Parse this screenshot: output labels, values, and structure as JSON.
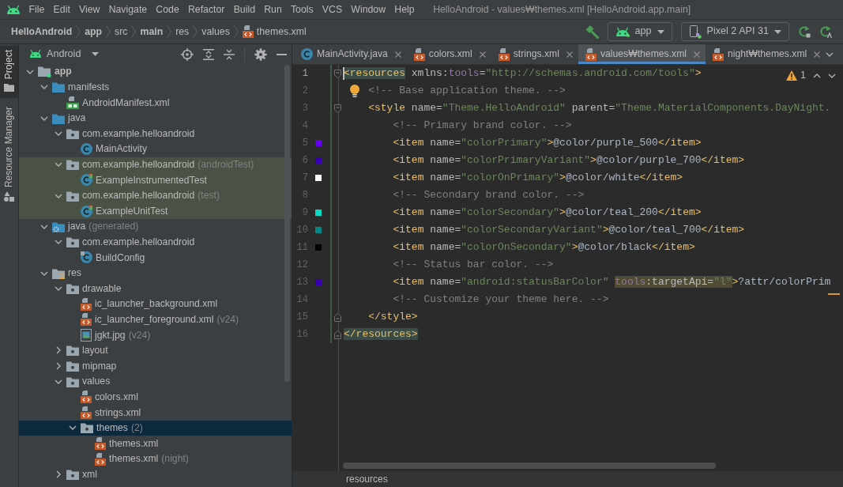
{
  "menu_bar": {
    "items": [
      "File",
      "Edit",
      "View",
      "Navigate",
      "Code",
      "Refactor",
      "Build",
      "Run",
      "Tools",
      "VCS",
      "Window",
      "Help"
    ]
  },
  "window_title": "HelloAndroid - values₩themes.xml [HelloAndroid.app.main]",
  "navigation_bar": {
    "breadcrumbs": [
      {
        "label": "HelloAndroid",
        "kind": "folder",
        "bold": true
      },
      {
        "label": "app",
        "kind": "folder",
        "bold": true
      },
      {
        "label": "src",
        "kind": "folder",
        "bold": false
      },
      {
        "label": "main",
        "kind": "folder",
        "bold": true
      },
      {
        "label": "res",
        "kind": "folder",
        "bold": false
      },
      {
        "label": "values",
        "kind": "folder",
        "bold": false
      },
      {
        "label": "themes.xml",
        "kind": "xml",
        "bold": false
      }
    ],
    "run_configuration": "app",
    "device": "Pixel 2 API 31"
  },
  "tool_window_bar": [
    {
      "label": "Project",
      "kind": "project",
      "selected": true
    },
    {
      "label": "Resource Manager",
      "kind": "resources",
      "selected": false
    }
  ],
  "project_panel": {
    "view": "Android",
    "tree": [
      {
        "label": "app",
        "kind": "module",
        "expanded": true,
        "selected": false,
        "children": [
          {
            "label": "manifests",
            "kind": "source-folder",
            "expanded": true,
            "selected": false,
            "children": [
              {
                "label": "AndroidManifest.xml",
                "kind": "manifest",
                "selected": false
              }
            ]
          },
          {
            "label": "java",
            "kind": "source-folder",
            "expanded": true,
            "selected": false,
            "children": [
              {
                "label": "com.example.helloandroid",
                "kind": "package",
                "expanded": true,
                "selected": false,
                "children": [
                  {
                    "label": "MainActivity",
                    "kind": "class",
                    "selected": false
                  }
                ]
              },
              {
                "label": "com.example.helloandroid",
                "note": "(androidTest)",
                "kind": "test-package",
                "expanded": true,
                "selected": false,
                "children": [
                  {
                    "label": "ExampleInstrumentedTest",
                    "kind": "test-class",
                    "selected": false
                  }
                ]
              },
              {
                "label": "com.example.helloandroid",
                "note": "(test)",
                "kind": "test-package",
                "expanded": true,
                "selected": false,
                "children": [
                  {
                    "label": "ExampleUnitTest",
                    "kind": "test-class",
                    "selected": false
                  }
                ]
              }
            ]
          },
          {
            "label": "java",
            "note": "(generated)",
            "kind": "generated-folder",
            "expanded": true,
            "selected": false,
            "children": [
              {
                "label": "com.example.helloandroid",
                "kind": "package",
                "expanded": true,
                "selected": false,
                "children": [
                  {
                    "label": "BuildConfig",
                    "kind": "config-class",
                    "selected": false
                  }
                ]
              }
            ]
          },
          {
            "label": "res",
            "kind": "resource-folder",
            "expanded": true,
            "selected": false,
            "children": [
              {
                "label": "drawable",
                "kind": "directory",
                "expanded": true,
                "selected": false,
                "children": [
                  {
                    "label": "ic_launcher_background.xml",
                    "kind": "xml",
                    "selected": false
                  },
                  {
                    "label": "ic_launcher_foreground.xml",
                    "note": "(v24)",
                    "kind": "xml",
                    "selected": false
                  },
                  {
                    "label": "jgkt.jpg",
                    "note": "(v24)",
                    "kind": "image",
                    "selected": false
                  }
                ]
              },
              {
                "label": "layout",
                "kind": "directory",
                "expanded": false,
                "selected": false
              },
              {
                "label": "mipmap",
                "kind": "directory",
                "expanded": false,
                "selected": false
              },
              {
                "label": "values",
                "kind": "directory",
                "expanded": true,
                "selected": false,
                "children": [
                  {
                    "label": "colors.xml",
                    "kind": "xml",
                    "selected": false
                  },
                  {
                    "label": "strings.xml",
                    "kind": "xml",
                    "selected": false
                  },
                  {
                    "label": "themes",
                    "note": "(2)",
                    "kind": "directory",
                    "expanded": true,
                    "selected": true,
                    "children": [
                      {
                        "label": "themes.xml",
                        "kind": "xml",
                        "selected": false
                      },
                      {
                        "label": "themes.xml",
                        "note": "(night)",
                        "kind": "xml",
                        "selected": false
                      }
                    ]
                  }
                ]
              },
              {
                "label": "xml",
                "kind": "directory",
                "expanded": false,
                "selected": false
              }
            ]
          }
        ]
      }
    ]
  },
  "editor": {
    "tabs": [
      {
        "label": "MainActivity.java",
        "kind": "class",
        "selected": false
      },
      {
        "label": "colors.xml",
        "kind": "xml",
        "selected": false
      },
      {
        "label": "strings.xml",
        "kind": "xml",
        "selected": false
      },
      {
        "label": "values₩themes.xml",
        "kind": "xml",
        "selected": true
      },
      {
        "label": "night₩themes.xml",
        "kind": "xml",
        "selected": false
      }
    ],
    "inspection_count": "1",
    "lines": [
      {
        "number": "1",
        "caret": true,
        "fold": {
          "kind": "start"
        },
        "tokens": [
          {
            "kind": "tag",
            "text": "<resources",
            "highlight": {
              "kind": "match"
            }
          },
          {
            "kind": "attr",
            "text": " xmlns:"
          },
          {
            "kind": "ns",
            "text": "tools"
          },
          {
            "kind": "attr",
            "text": "="
          },
          {
            "kind": "value",
            "text": "\"http://schemas.android.com/tools\""
          },
          {
            "kind": "tag",
            "text": ">"
          }
        ]
      },
      {
        "number": "2",
        "caret": false,
        "marker": {
          "kind": "bulb"
        },
        "tokens": [
          {
            "kind": "comment",
            "text": "    <!-- Base application theme. -->"
          }
        ]
      },
      {
        "number": "3",
        "caret": false,
        "fold": {
          "kind": "start"
        },
        "tokens": [
          {
            "kind": "tag",
            "text": "    <style"
          },
          {
            "kind": "attr",
            "text": " name="
          },
          {
            "kind": "value",
            "text": "\"Theme.HelloAndroid\""
          },
          {
            "kind": "attr",
            "text": " parent="
          },
          {
            "kind": "value",
            "text": "\"Theme.MaterialComponents.DayNight."
          }
        ]
      },
      {
        "number": "4",
        "caret": false,
        "tokens": [
          {
            "kind": "comment",
            "text": "        <!-- Primary brand color. -->"
          }
        ]
      },
      {
        "number": "5",
        "caret": false,
        "color": "#6200ee",
        "tokens": [
          {
            "kind": "tag",
            "text": "        <item"
          },
          {
            "kind": "attr",
            "text": " name="
          },
          {
            "kind": "value",
            "text": "\"colorPrimary\""
          },
          {
            "kind": "tag",
            "text": ">"
          },
          {
            "kind": "text",
            "text": "@color/purple_500"
          },
          {
            "kind": "tag",
            "text": "</item>"
          }
        ]
      },
      {
        "number": "6",
        "caret": false,
        "color": "#3700b3",
        "tokens": [
          {
            "kind": "tag",
            "text": "        <item"
          },
          {
            "kind": "attr",
            "text": " name="
          },
          {
            "kind": "value",
            "text": "\"colorPrimaryVariant\""
          },
          {
            "kind": "tag",
            "text": ">"
          },
          {
            "kind": "text",
            "text": "@color/purple_700"
          },
          {
            "kind": "tag",
            "text": "</item>"
          }
        ]
      },
      {
        "number": "7",
        "caret": false,
        "color": "#ffffff",
        "tokens": [
          {
            "kind": "tag",
            "text": "        <item"
          },
          {
            "kind": "attr",
            "text": " name="
          },
          {
            "kind": "value",
            "text": "\"colorOnPrimary\""
          },
          {
            "kind": "tag",
            "text": ">"
          },
          {
            "kind": "text",
            "text": "@color/white"
          },
          {
            "kind": "tag",
            "text": "</item>"
          }
        ]
      },
      {
        "number": "8",
        "caret": false,
        "tokens": [
          {
            "kind": "comment",
            "text": "        <!-- Secondary brand color. -->"
          }
        ]
      },
      {
        "number": "9",
        "caret": false,
        "color": "#03dac5",
        "tokens": [
          {
            "kind": "tag",
            "text": "        <item"
          },
          {
            "kind": "attr",
            "text": " name="
          },
          {
            "kind": "value",
            "text": "\"colorSecondary\""
          },
          {
            "kind": "tag",
            "text": ">"
          },
          {
            "kind": "text",
            "text": "@color/teal_200"
          },
          {
            "kind": "tag",
            "text": "</item>"
          }
        ]
      },
      {
        "number": "10",
        "caret": false,
        "color": "#018786",
        "tokens": [
          {
            "kind": "tag",
            "text": "        <item"
          },
          {
            "kind": "attr",
            "text": " name="
          },
          {
            "kind": "value",
            "text": "\"colorSecondaryVariant\""
          },
          {
            "kind": "tag",
            "text": ">"
          },
          {
            "kind": "text",
            "text": "@color/teal_700"
          },
          {
            "kind": "tag",
            "text": "</item>"
          }
        ]
      },
      {
        "number": "11",
        "caret": false,
        "color": "#000000",
        "tokens": [
          {
            "kind": "tag",
            "text": "        <item"
          },
          {
            "kind": "attr",
            "text": " name="
          },
          {
            "kind": "value",
            "text": "\"colorOnSecondary\""
          },
          {
            "kind": "tag",
            "text": ">"
          },
          {
            "kind": "text",
            "text": "@color/black"
          },
          {
            "kind": "tag",
            "text": "</item>"
          }
        ]
      },
      {
        "number": "12",
        "caret": false,
        "tokens": [
          {
            "kind": "comment",
            "text": "        <!-- Status bar color. -->"
          }
        ]
      },
      {
        "number": "13",
        "caret": false,
        "color": "#3700b3",
        "tokens": [
          {
            "kind": "tag",
            "text": "        <item"
          },
          {
            "kind": "attr",
            "text": " name="
          },
          {
            "kind": "value",
            "text": "\"android:statusBarColor\" "
          },
          {
            "kind": "ns",
            "text": "tools",
            "highlight": {
              "kind": "warning"
            }
          },
          {
            "kind": "attr",
            "text": ":targetApi=",
            "highlight": {
              "kind": "warning"
            }
          },
          {
            "kind": "value",
            "text": "\"l\"",
            "highlight": {
              "kind": "warning"
            }
          },
          {
            "kind": "tag",
            "text": ">"
          },
          {
            "kind": "text",
            "text": "?attr/colorPrim"
          }
        ]
      },
      {
        "number": "14",
        "caret": false,
        "tokens": [
          {
            "kind": "comment",
            "text": "        <!-- Customize your theme here. -->"
          }
        ]
      },
      {
        "number": "15",
        "caret": false,
        "fold": {
          "kind": "end"
        },
        "tokens": [
          {
            "kind": "tag",
            "text": "    </style>"
          }
        ]
      },
      {
        "number": "16",
        "caret": false,
        "fold": {
          "kind": "end"
        },
        "tokens": [
          {
            "kind": "tag",
            "text": "</resources>",
            "highlight": {
              "kind": "match"
            }
          }
        ]
      }
    ],
    "breadcrumb": "resources"
  }
}
